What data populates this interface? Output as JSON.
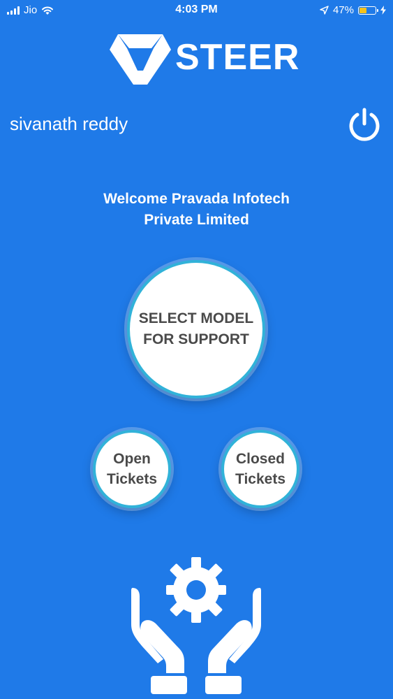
{
  "status_bar": {
    "carrier": "Jio",
    "time": "4:03 PM",
    "battery": "47%",
    "battery_level": 0.47,
    "icons": [
      "signal-icon",
      "wifi-icon",
      "location-icon",
      "battery-icon",
      "charging-icon"
    ]
  },
  "header": {
    "logo_text": "STEER",
    "username": "sivanath reddy",
    "power_icon": "power-icon"
  },
  "main": {
    "welcome_line1": "Welcome Pravada Infotech",
    "welcome_line2": "Private Limited",
    "select_model_line1": "SELECT MODEL",
    "select_model_line2": "FOR SUPPORT",
    "open_tickets_line1": "Open",
    "open_tickets_line2": "Tickets",
    "closed_tickets_line1": "Closed",
    "closed_tickets_line2": "Tickets"
  },
  "footer": {
    "graphic_icon": "hands-gear-icon"
  },
  "colors": {
    "background": "#1f7ae8",
    "button_border": "#31b2d9",
    "button_text": "#4a4a4a",
    "battery_fill": "#f5c21b"
  }
}
